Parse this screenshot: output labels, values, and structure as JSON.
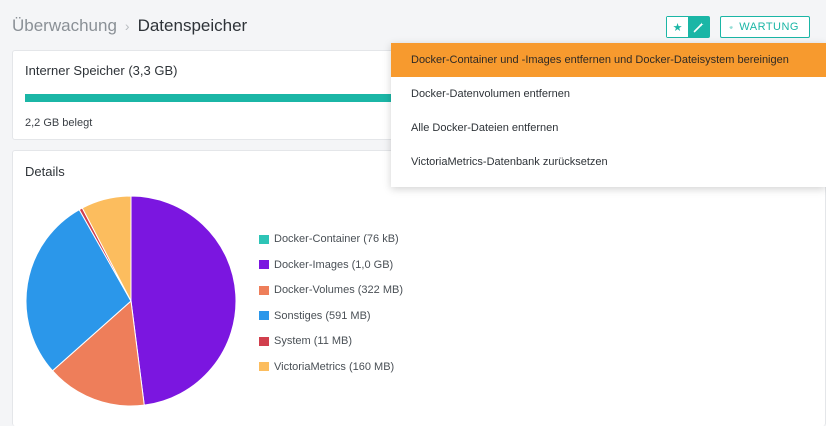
{
  "breadcrumb": {
    "parent": "Überwachung",
    "separator": "›",
    "current": "Datenspeicher"
  },
  "toolbar": {
    "star_icon": "star-icon",
    "wand_icon": "magic-wand-icon",
    "gear_icon": "gear-icon",
    "maintenance_label": "WARTUNG"
  },
  "storage": {
    "title": "Interner Speicher (3,3 GB)",
    "used_label": "2,2 GB belegt",
    "used_fraction": 0.667
  },
  "details": {
    "title": "Details",
    "legend": [
      {
        "label": "Docker-Container (76 kB)",
        "color": "#2ec4b6"
      },
      {
        "label": "Docker-Images (1,0 GB)",
        "color": "#7b16e0"
      },
      {
        "label": "Docker-Volumes (322 MB)",
        "color": "#ee7e5a"
      },
      {
        "label": "Sonstiges (591 MB)",
        "color": "#2b97ea"
      },
      {
        "label": "System (11 MB)",
        "color": "#d13f4d"
      },
      {
        "label": "VictoriaMetrics (160 MB)",
        "color": "#fcbd5e"
      }
    ]
  },
  "chart_data": {
    "type": "pie",
    "categories": [
      "Docker-Container",
      "Docker-Images",
      "Docker-Volumes",
      "Sonstiges",
      "System",
      "VictoriaMetrics"
    ],
    "values": [
      7.6e-05,
      1.0,
      0.322,
      0.591,
      0.011,
      0.16
    ],
    "unit": "GB",
    "colors": [
      "#2ec4b6",
      "#7b16e0",
      "#ee7e5a",
      "#2b97ea",
      "#d13f4d",
      "#fcbd5e"
    ]
  },
  "menu": {
    "items": [
      {
        "label": "Docker-Container und -Images entfernen und Docker-Dateisystem bereinigen",
        "highlighted": true
      },
      {
        "label": "Docker-Datenvolumen entfernen",
        "highlighted": false
      },
      {
        "label": "Alle Docker-Dateien entfernen",
        "highlighted": false
      },
      {
        "label": "VictoriaMetrics-Datenbank zurücksetzen",
        "highlighted": false
      }
    ]
  }
}
